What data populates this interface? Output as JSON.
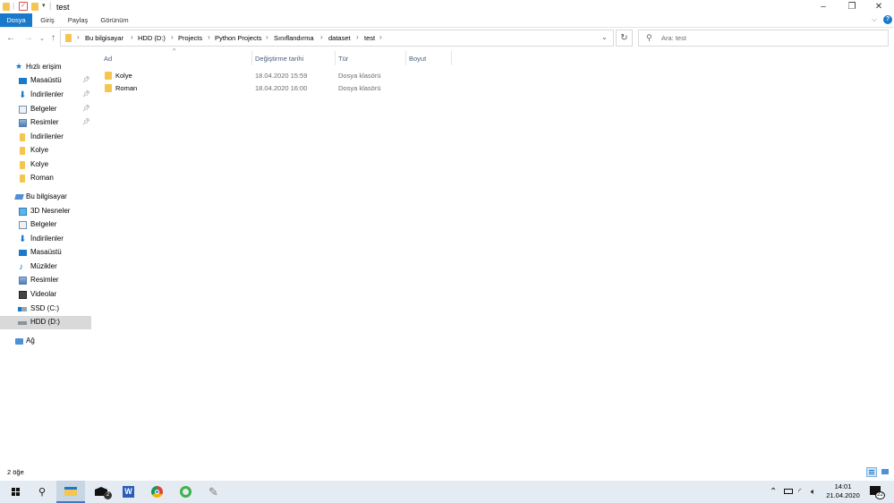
{
  "window": {
    "title": "test",
    "controls": {
      "minimize": "–",
      "restore": "❐",
      "close": "✕"
    }
  },
  "ribbon": {
    "tabs": [
      "Dosya",
      "Giriş",
      "Paylaş",
      "Görünüm"
    ],
    "active_tab": "Dosya",
    "help_icon": "?"
  },
  "address": {
    "crumbs": [
      "Bu bilgisayar",
      "HDD (D:)",
      "Projects",
      "Python Projects",
      "Sınıflandırma",
      "dataset",
      "test"
    ],
    "search_placeholder": "Ara: test"
  },
  "nav": {
    "items": [
      {
        "label": "Hızlı erişim",
        "icon": "star-icon"
      },
      {
        "label": "Masaüstü",
        "icon": "desktop-icon",
        "pinned": true
      },
      {
        "label": "İndirilenler",
        "icon": "download-icon",
        "pinned": true
      },
      {
        "label": "Belgeler",
        "icon": "documents-icon",
        "pinned": true
      },
      {
        "label": "Resimler",
        "icon": "pictures-icon",
        "pinned": true
      },
      {
        "label": "İndirilenler",
        "icon": "folder-icon"
      },
      {
        "label": "Kolye",
        "icon": "folder-icon"
      },
      {
        "label": "Kolye",
        "icon": "folder-icon"
      },
      {
        "label": "Roman",
        "icon": "folder-icon"
      },
      {
        "label": "Bu bilgisayar",
        "icon": "computer-icon"
      },
      {
        "label": "3D Nesneler",
        "icon": "3d-objects-icon"
      },
      {
        "label": "Belgeler",
        "icon": "documents-icon"
      },
      {
        "label": "İndirilenler",
        "icon": "download-icon"
      },
      {
        "label": "Masaüstü",
        "icon": "desktop-icon"
      },
      {
        "label": "Müzikler",
        "icon": "music-icon"
      },
      {
        "label": "Resimler",
        "icon": "pictures-icon"
      },
      {
        "label": "Videolar",
        "icon": "videos-icon"
      },
      {
        "label": "SSD (C:)",
        "icon": "drive-c-icon"
      },
      {
        "label": "HDD (D:)",
        "icon": "drive-d-icon",
        "selected": true
      },
      {
        "label": "Ağ",
        "icon": "network-icon"
      }
    ]
  },
  "columns": [
    "Ad",
    "Değiştirme tarihi",
    "Tür",
    "Boyut"
  ],
  "files": [
    {
      "name": "Kolye",
      "date": "18.04.2020 15:59",
      "type": "Dosya klasörü",
      "size": ""
    },
    {
      "name": "Roman",
      "date": "18.04.2020 16:00",
      "type": "Dosya klasörü",
      "size": ""
    }
  ],
  "status": {
    "count": "2 öğe"
  },
  "taskbar": {
    "mail_badge": "2",
    "clock_time": "14:01",
    "clock_date": "21.04.2020",
    "notification_count": "22"
  },
  "colors": {
    "accent": "#1979ca",
    "folder": "#f4c54f",
    "taskbar": "#e4ebf2",
    "selection": "#d9d9d9"
  }
}
